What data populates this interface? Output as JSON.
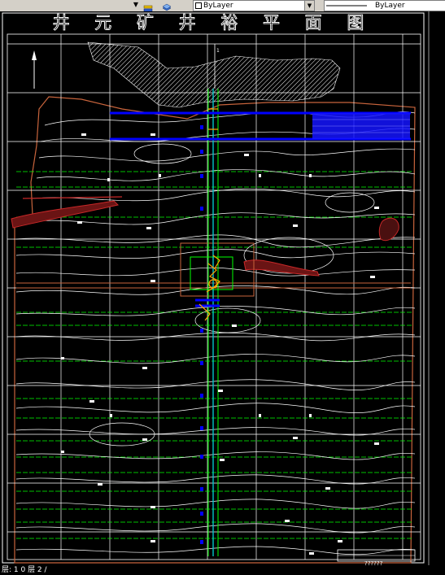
{
  "toolbar": {
    "color_combo": "ByLayer",
    "linetype_combo": "ByLayer",
    "icons": [
      "layer-manager-icon",
      "layer-stack-icon"
    ]
  },
  "drawing": {
    "title": "井 元 矿 井 裕 平 面 图",
    "north_arrow_label": "N",
    "axis_label_top": "1",
    "title_block_text": "??????",
    "colors": {
      "background": "#000000",
      "grid_white": "#ffffff",
      "grid_green": "#00ff00",
      "boundary": "#c8643c",
      "roadway_blue": "#0000ff",
      "cyan_line": "#00c8c8",
      "orange_mark": "#ffa500",
      "red_zone": "#c82828"
    }
  },
  "status_bar": {
    "text": "层: 1 0 层 2 /"
  }
}
